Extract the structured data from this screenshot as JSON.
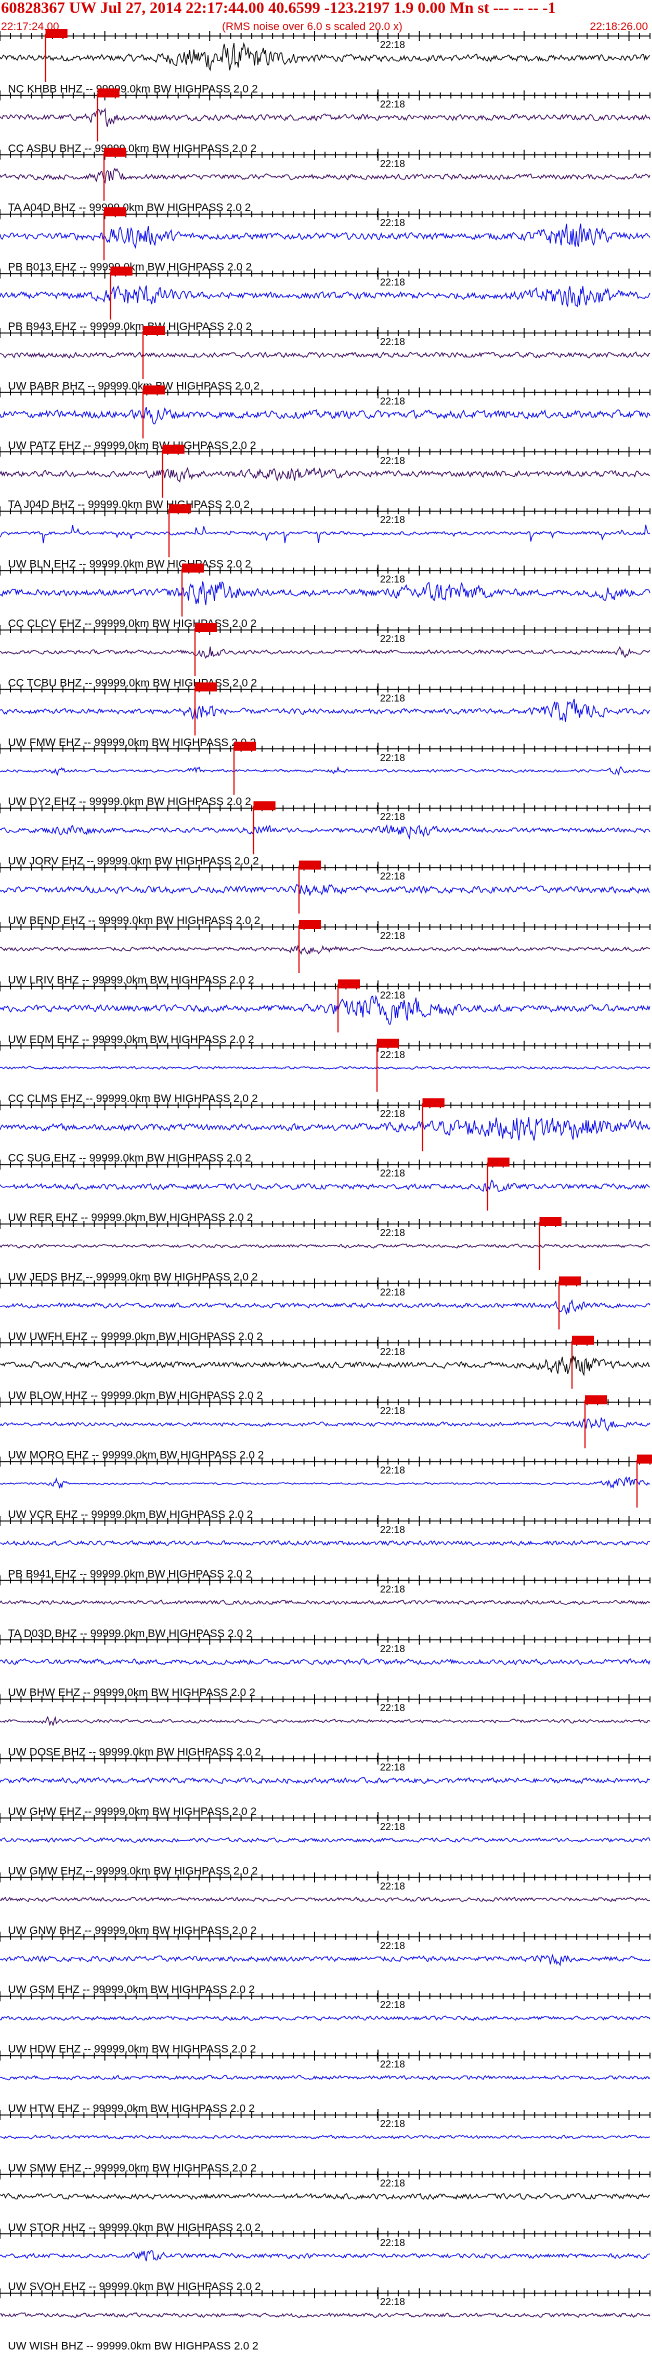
{
  "header": {
    "title": "60828367 UW Jul 27, 2014 22:17:44.00   40.6599 -123.2197  1.9 0.00 Mn st --- -- --  -1",
    "start_time": "22:17:24.00",
    "note": "(RMS noise over 6.0 s scaled 20.0 x)",
    "end_time": "22:18:26.00"
  },
  "colors": {
    "header_text": "#d40000",
    "pick": "#e00000",
    "trace_blue": "#0000ee",
    "trace_purple": "#33005a",
    "trace_black": "#000000",
    "axis": "#000000",
    "label": "#000000"
  },
  "chart_data": {
    "type": "seismogram",
    "x_range": [
      "22:17:24.00",
      "22:18:26.00"
    ],
    "marker_label": "22:18",
    "traces": [
      {
        "label": "NC KHBB HHZ -- 99999.0km BW  HIGHPASS  2.0  2",
        "color": "black",
        "amp": 1.0,
        "pick": 0.07,
        "events": [
          {
            "pos": 0.35,
            "amp": 3.5,
            "w": 0.08
          }
        ]
      },
      {
        "label": "CC ASBU BHZ -- 99999.0km BW  HIGHPASS  2.0  2",
        "color": "purple",
        "amp": 0.9,
        "pick": 0.15,
        "events": [
          {
            "pos": 0.16,
            "amp": 2.0,
            "w": 0.02
          }
        ]
      },
      {
        "label": "TA A04D BHZ -- 99999.0km BW  HIGHPASS  2.0  2",
        "color": "purple",
        "amp": 0.8,
        "pick": 0.16,
        "events": [
          {
            "pos": 0.17,
            "amp": 1.8,
            "w": 0.02
          }
        ]
      },
      {
        "label": "PB B013 EHZ -- 99999.0km BW  HIGHPASS  2.0  2",
        "color": "blue",
        "amp": 1.0,
        "pick": 0.16,
        "events": [
          {
            "pos": 0.21,
            "amp": 2.5,
            "w": 0.05
          },
          {
            "pos": 0.88,
            "amp": 3.0,
            "w": 0.05
          }
        ]
      },
      {
        "label": "PB B943 EHZ -- 99999.0km BW  HIGHPASS  2.0  2",
        "color": "blue",
        "amp": 1.0,
        "pick": 0.17,
        "events": [
          {
            "pos": 0.21,
            "amp": 2.8,
            "w": 0.05
          },
          {
            "pos": 0.88,
            "amp": 3.0,
            "w": 0.06
          }
        ]
      },
      {
        "label": "UW BABR BHZ -- 99999.0km BW  HIGHPASS  2.0  2",
        "color": "purple",
        "amp": 0.8,
        "pick": 0.22,
        "events": []
      },
      {
        "label": "UW PATZ EHZ -- 99999.0km BW  HIGHPASS  2.0  2",
        "color": "blue",
        "amp": 1.2,
        "pick": 0.22,
        "events": [
          {
            "pos": 0.24,
            "amp": 2.0,
            "w": 0.02
          }
        ]
      },
      {
        "label": "TA J04D BHZ -- 99999.0km BW  HIGHPASS  2.0  2",
        "color": "purple",
        "amp": 0.9,
        "pick": 0.25,
        "events": [
          {
            "pos": 0.27,
            "amp": 1.5,
            "w": 0.03
          },
          {
            "pos": 0.45,
            "amp": 1.5,
            "w": 0.06
          }
        ]
      },
      {
        "label": "UW BLN EHZ -- 99999.0km BW  HIGHPASS  2.0  2",
        "color": "blue",
        "amp": 0.5,
        "pick": 0.26,
        "events": [],
        "spiky": true
      },
      {
        "label": "CC CLCV EHZ -- 99999.0km BW  HIGHPASS  2.0  2",
        "color": "blue",
        "amp": 1.0,
        "pick": 0.28,
        "events": [
          {
            "pos": 0.32,
            "amp": 3.5,
            "w": 0.04
          },
          {
            "pos": 0.68,
            "amp": 2.5,
            "w": 0.06
          },
          {
            "pos": 0.94,
            "amp": 1.8,
            "w": 0.02
          }
        ]
      },
      {
        "label": "CC TCBU BHZ -- 99999.0km BW  HIGHPASS  2.0  2",
        "color": "purple",
        "amp": 0.6,
        "pick": 0.3,
        "events": [
          {
            "pos": 0.32,
            "amp": 1.8,
            "w": 0.02
          },
          {
            "pos": 0.96,
            "amp": 1.5,
            "w": 0.01
          }
        ]
      },
      {
        "label": "UW FMW EHZ -- 99999.0km BW  HIGHPASS  2.0  2",
        "color": "blue",
        "amp": 0.8,
        "pick": 0.3,
        "events": [
          {
            "pos": 0.31,
            "amp": 3.5,
            "w": 0.02
          },
          {
            "pos": 0.88,
            "amp": 3.2,
            "w": 0.04
          }
        ]
      },
      {
        "label": "UW DY2 EHZ -- 99999.0km BW  HIGHPASS  2.0  2",
        "color": "blue",
        "amp": 0.4,
        "pick": 0.36,
        "events": [
          {
            "pos": 0.09,
            "amp": 1.0,
            "w": 0.01
          },
          {
            "pos": 0.3,
            "amp": 1.0,
            "w": 0.01
          },
          {
            "pos": 0.52,
            "amp": 0.9,
            "w": 0.01
          },
          {
            "pos": 0.95,
            "amp": 1.2,
            "w": 0.01
          }
        ]
      },
      {
        "label": "UW JORV EHZ -- 99999.0km BW  HIGHPASS  2.0  2",
        "color": "blue",
        "amp": 0.7,
        "pick": 0.39,
        "events": [
          {
            "pos": 0.11,
            "amp": 1.2,
            "w": 0.03
          },
          {
            "pos": 0.4,
            "amp": 1.2,
            "w": 0.02
          },
          {
            "pos": 0.63,
            "amp": 1.5,
            "w": 0.04
          }
        ]
      },
      {
        "label": "UW BEND EHZ -- 99999.0km BW  HIGHPASS  2.0  2",
        "color": "blue",
        "amp": 1.0,
        "pick": 0.46,
        "events": [
          {
            "pos": 0.48,
            "amp": 1.5,
            "w": 0.03
          }
        ]
      },
      {
        "label": "UW LRIV BHZ -- 99999.0km BW  HIGHPASS  2.0  2",
        "color": "purple",
        "amp": 0.6,
        "pick": 0.46,
        "events": [
          {
            "pos": 0.48,
            "amp": 1.3,
            "w": 0.03
          }
        ]
      },
      {
        "label": "UW EDM EHZ -- 99999.0km BW  HIGHPASS  2.0  2",
        "color": "blue",
        "amp": 1.0,
        "pick": 0.52,
        "events": [
          {
            "pos": 0.6,
            "amp": 3.5,
            "w": 0.08
          }
        ]
      },
      {
        "label": "CC CLMS EHZ -- 99999.0km BW  HIGHPASS  2.0  2",
        "color": "blue",
        "amp": 0.4,
        "pick": 0.58,
        "events": []
      },
      {
        "label": "CC SUG EHZ -- 99999.0km BW  HIGHPASS  2.0  2",
        "color": "blue",
        "amp": 1.0,
        "pick": 0.65,
        "events": [
          {
            "pos": 0.82,
            "amp": 3.0,
            "w": 0.15
          }
        ]
      },
      {
        "label": "UW RER EHZ -- 99999.0km BW  HIGHPASS  2.0  2",
        "color": "blue",
        "amp": 0.8,
        "pick": 0.75,
        "events": [
          {
            "pos": 0.76,
            "amp": 2.0,
            "w": 0.02
          }
        ]
      },
      {
        "label": "UW JEDS BHZ -- 99999.0km BW  HIGHPASS  2.0  2",
        "color": "purple",
        "amp": 0.5,
        "pick": 0.83,
        "events": []
      },
      {
        "label": "UW UWFH EHZ -- 99999.0km BW  HIGHPASS  2.0  2",
        "color": "blue",
        "amp": 0.7,
        "pick": 0.86,
        "events": [
          {
            "pos": 0.875,
            "amp": 2.0,
            "w": 0.02
          }
        ]
      },
      {
        "label": "UW BLOW HHZ -- 99999.0km BW  HIGHPASS  2.0  2",
        "color": "black",
        "amp": 0.9,
        "pick": 0.88,
        "events": [
          {
            "pos": 0.88,
            "amp": 2.8,
            "w": 0.04
          }
        ]
      },
      {
        "label": "UW MORO EHZ -- 99999.0km BW  HIGHPASS  2.0  2",
        "color": "blue",
        "amp": 0.6,
        "pick": 0.9,
        "events": [
          {
            "pos": 0.92,
            "amp": 2.0,
            "w": 0.03
          }
        ]
      },
      {
        "label": "UW VCR EHZ -- 99999.0km BW  HIGHPASS  2.0  2",
        "color": "blue",
        "amp": 0.3,
        "pick": 0.98,
        "events": [
          {
            "pos": 0.09,
            "amp": 1.5,
            "w": 0.01
          },
          {
            "pos": 0.96,
            "amp": 1.8,
            "w": 0.03
          }
        ]
      },
      {
        "label": "PB B941 EHZ -- 99999.0km BW  HIGHPASS  2.0  2",
        "color": "blue",
        "amp": 0.7,
        "pick": null,
        "events": []
      },
      {
        "label": "TA D03D BHZ -- 99999.0km BW  HIGHPASS  2.0  2",
        "color": "purple",
        "amp": 0.6,
        "pick": null,
        "events": []
      },
      {
        "label": "UW BHW EHZ -- 99999.0km BW  HIGHPASS  2.0  2",
        "color": "blue",
        "amp": 0.8,
        "pick": null,
        "events": []
      },
      {
        "label": "UW DOSE BHZ -- 99999.0km BW  HIGHPASS  2.0  2",
        "color": "purple",
        "amp": 0.5,
        "pick": null,
        "events": [
          {
            "pos": 0.08,
            "amp": 1.2,
            "w": 0.01
          }
        ]
      },
      {
        "label": "UW GHW EHZ -- 99999.0km BW  HIGHPASS  2.0  2",
        "color": "blue",
        "amp": 0.8,
        "pick": null,
        "events": []
      },
      {
        "label": "UW GMW EHZ -- 99999.0km BW  HIGHPASS  2.0  2",
        "color": "blue",
        "amp": 0.6,
        "pick": null,
        "events": []
      },
      {
        "label": "UW GNW BHZ -- 99999.0km BW  HIGHPASS  2.0  2",
        "color": "purple",
        "amp": 0.6,
        "pick": null,
        "events": []
      },
      {
        "label": "UW GSM EHZ -- 99999.0km BW  HIGHPASS  2.0  2",
        "color": "blue",
        "amp": 0.8,
        "pick": null,
        "events": [
          {
            "pos": 0.85,
            "amp": 1.5,
            "w": 0.02
          }
        ]
      },
      {
        "label": "UW HDW EHZ -- 99999.0km BW  HIGHPASS  2.0  2",
        "color": "blue",
        "amp": 0.6,
        "pick": null,
        "events": []
      },
      {
        "label": "UW HTW EHZ -- 99999.0km BW  HIGHPASS  2.0  2",
        "color": "blue",
        "amp": 0.6,
        "pick": null,
        "events": []
      },
      {
        "label": "UW SMW EHZ -- 99999.0km BW  HIGHPASS  2.0  2",
        "color": "blue",
        "amp": 0.5,
        "pick": null,
        "events": []
      },
      {
        "label": "UW STOR HHZ -- 99999.0km BW  HIGHPASS  2.0  2",
        "color": "black",
        "amp": 0.8,
        "pick": null,
        "events": []
      },
      {
        "label": "UW SVOH EHZ -- 99999.0km BW  HIGHPASS  2.0  2",
        "color": "blue",
        "amp": 0.7,
        "pick": null,
        "events": [
          {
            "pos": 0.23,
            "amp": 1.3,
            "w": 0.02
          }
        ]
      },
      {
        "label": "UW WISH BHZ -- 99999.0km BW  HIGHPASS  2.0  2",
        "color": "purple",
        "amp": 0.6,
        "pick": null,
        "events": []
      }
    ]
  }
}
